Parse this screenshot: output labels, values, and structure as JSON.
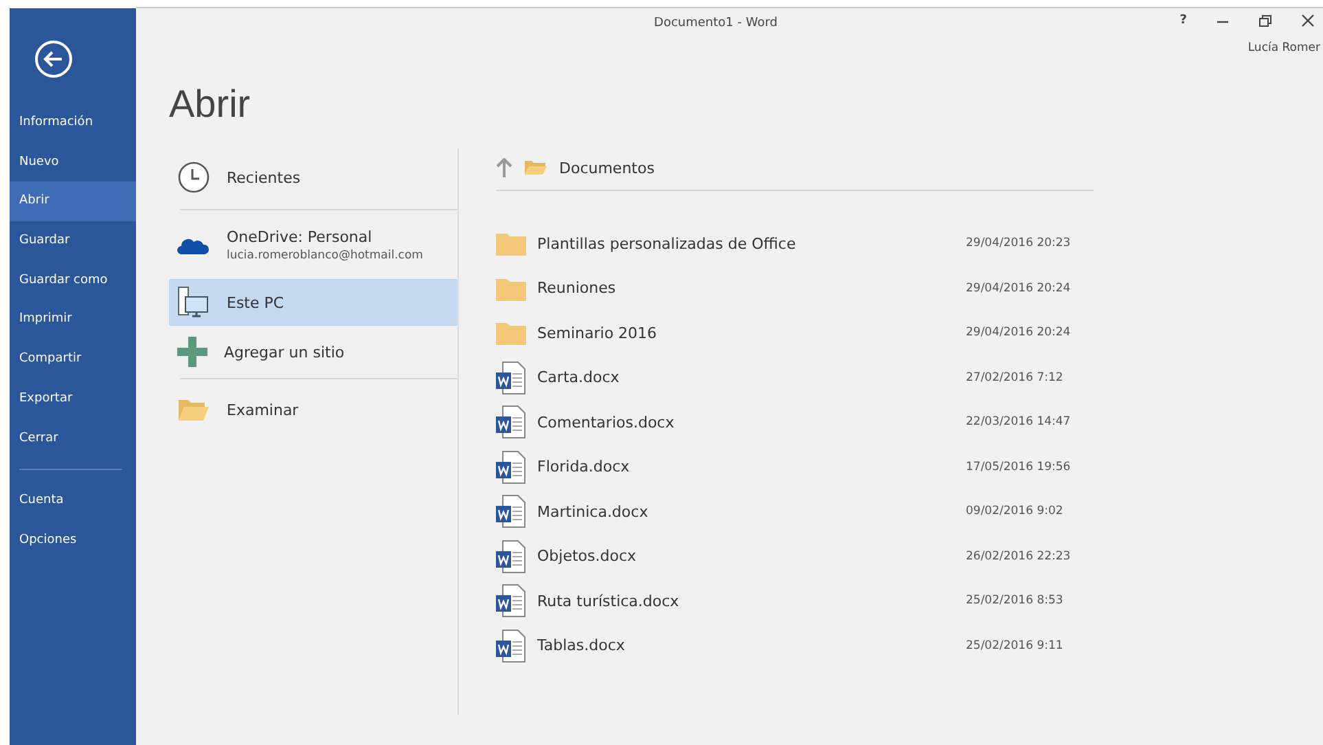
{
  "window": {
    "title": "Documento1 - Word",
    "help": "?",
    "user": "Lucía Romer"
  },
  "sidebar": {
    "items": [
      {
        "label": "Información",
        "selected": false
      },
      {
        "label": "Nuevo",
        "selected": false
      },
      {
        "label": "Abrir",
        "selected": true
      },
      {
        "label": "Guardar",
        "selected": false
      },
      {
        "label": "Guardar como",
        "selected": false
      },
      {
        "label": "Imprimir",
        "selected": false
      },
      {
        "label": "Compartir",
        "selected": false
      },
      {
        "label": "Exportar",
        "selected": false
      },
      {
        "label": "Cerrar",
        "selected": false
      },
      {
        "label": "Cuenta",
        "selected": false,
        "divider_before": true
      },
      {
        "label": "Opciones",
        "selected": false
      }
    ]
  },
  "page_title": "Abrir",
  "places": [
    {
      "kind": "recent",
      "label": "Recientes",
      "selected": false
    },
    {
      "kind": "cloud",
      "label": "OneDrive: Personal",
      "detail": "lucia.romeroblanco@hotmail.com",
      "selected": false
    },
    {
      "kind": "pc",
      "label": "Este PC",
      "selected": true
    },
    {
      "kind": "add",
      "label": "Agregar un sitio",
      "selected": false
    },
    {
      "kind": "browse",
      "label": "Examinar",
      "selected": false
    }
  ],
  "breadcrumb": "Documentos",
  "files": [
    {
      "kind": "folder",
      "name": "Plantillas personalizadas de Office",
      "date": "29/04/2016 20:23"
    },
    {
      "kind": "folder",
      "name": "Reuniones",
      "date": "29/04/2016 20:24"
    },
    {
      "kind": "folder",
      "name": "Seminario 2016",
      "date": "29/04/2016 20:24"
    },
    {
      "kind": "docx",
      "name": "Carta.docx",
      "date": "27/02/2016 7:12"
    },
    {
      "kind": "docx",
      "name": "Comentarios.docx",
      "date": "22/03/2016 14:47"
    },
    {
      "kind": "docx",
      "name": "Florida.docx",
      "date": "17/05/2016 19:56"
    },
    {
      "kind": "docx",
      "name": "Martinica.docx",
      "date": "09/02/2016 9:02"
    },
    {
      "kind": "docx",
      "name": "Objetos.docx",
      "date": "26/02/2016 22:23"
    },
    {
      "kind": "docx",
      "name": "Ruta turística.docx",
      "date": "25/02/2016 8:53"
    },
    {
      "kind": "docx",
      "name": "Tablas.docx",
      "date": "25/02/2016 9:11"
    }
  ]
}
